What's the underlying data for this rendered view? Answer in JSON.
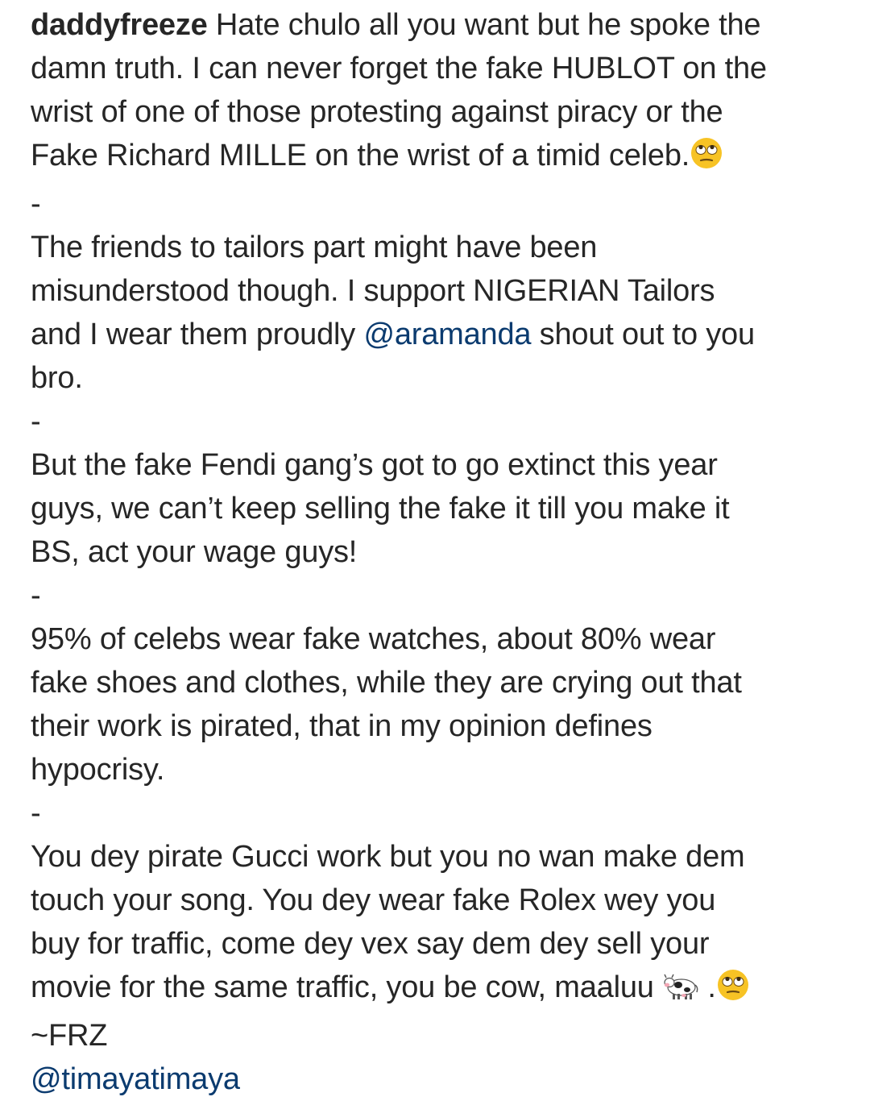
{
  "post": {
    "username": "daddyfreeze",
    "p1": {
      "l1": "Hate chulo all you want but he spoke the",
      "l2": "damn truth. I can never forget the fake HUBLOT on the",
      "l3": "wrist of one of those protesting against piracy or the",
      "l4": "Fake Richard MILLE on the wrist of a timid celeb."
    },
    "sep1": "-",
    "p2": {
      "l1": "The friends to tailors part might have been",
      "l2": "misunderstood though. I support NIGERIAN Tailors",
      "l3_pre": "and I wear them proudly ",
      "mention": "@aramanda",
      "l3_post": " shout out to you",
      "l4": "bro."
    },
    "sep2": "-",
    "p3": {
      "l1": "But the fake Fendi gang’s got to go extinct this year",
      "l2": "guys, we can’t keep selling the fake it till you make it",
      "l3": "BS, act your wage guys!"
    },
    "sep3": "-",
    "p4": {
      "l1": "95% of celebs wear fake watches, about 80% wear",
      "l2": "fake shoes and clothes, while they are crying out that",
      "l3": "their work is pirated, that in my opinion defines",
      "l4": "hypocrisy."
    },
    "sep4": "-",
    "p5": {
      "l1": "You dey pirate Gucci work but you no wan make dem",
      "l2": "touch your song. You dey wear fake Rolex wey you",
      "l3": "buy for traffic, come dey vex say dem dey sell your",
      "l4_pre": "movie for the same traffic, you be cow, maaluu ",
      "l4_mid": " .",
      "signature": "~FRZ",
      "tag": "@timayatimaya"
    },
    "icons": {
      "eye_roll": "face-with-rolling-eyes-emoji",
      "cow": "cow-emoji"
    },
    "colors": {
      "text": "#262626",
      "mention": "#0b3b6f",
      "emoji_face": "#f7c325"
    }
  }
}
